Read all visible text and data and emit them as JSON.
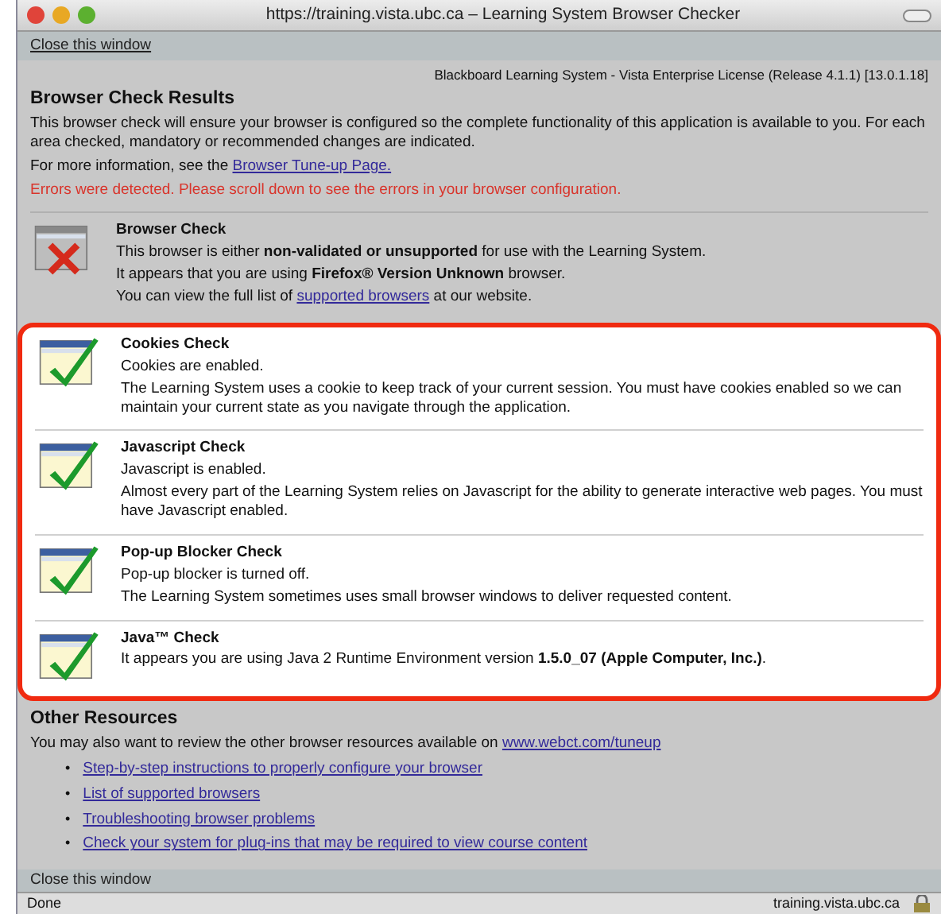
{
  "window": {
    "title": "https://training.vista.ubc.ca – Learning System Browser Checker"
  },
  "top_link": "Close this window",
  "license": "Blackboard Learning System - Vista Enterprise License (Release 4.1.1) [13.0.1.18]",
  "heading": "Browser Check Results",
  "intro": "This browser check will ensure your browser is configured so the complete functionality of this application is available to you. For each area checked, mandatory or recommended changes are indicated.",
  "more_info": {
    "before": "For more information, see the ",
    "link": "Browser Tune-up Page."
  },
  "error": "Errors were detected. Please scroll down to see the errors in your browser configuration.",
  "checks": [
    {
      "title": "Browser Check",
      "passed": false,
      "highlighted": false,
      "lines": [
        {
          "text": "This browser is either **non-validated or unsupported** for use with the Learning System."
        },
        {
          "text": "It appears that you are using **Firefox® Version Unknown** browser."
        },
        {
          "before": "You can view the full list of ",
          "link": "supported browsers",
          "after": " at our website."
        }
      ]
    },
    {
      "title": "Cookies Check",
      "passed": true,
      "highlighted": true,
      "lines": [
        {
          "text": "Cookies are enabled."
        },
        {
          "text": "The Learning System uses a cookie to keep track of your current session. You must have cookies enabled so we can maintain your current state as you navigate through the application."
        }
      ]
    },
    {
      "title": "Javascript Check",
      "passed": true,
      "highlighted": true,
      "lines": [
        {
          "text": "Javascript is enabled."
        },
        {
          "text": "Almost every part of the Learning System relies on Javascript for the ability to generate interactive web pages. You must have Javascript enabled."
        }
      ]
    },
    {
      "title": "Pop-up Blocker Check",
      "passed": true,
      "highlighted": true,
      "lines": [
        {
          "text": "Pop-up blocker is turned off."
        },
        {
          "text": "The Learning System sometimes uses small browser windows to deliver requested content."
        }
      ]
    },
    {
      "title": "Java™ Check",
      "passed": true,
      "highlighted": true,
      "lines": [
        {
          "text": "It appears you are using Java 2 Runtime Environment version **1.5.0_07 (Apple Computer, Inc.)**."
        }
      ]
    }
  ],
  "other_resources": {
    "heading": "Other Resources",
    "intro": {
      "before": "You may also want to review the other browser resources available on ",
      "link": "www.webct.com/tuneup"
    },
    "links": [
      {
        "bullet": "•",
        "text": "Step-by-step instructions to properly configure your browser"
      },
      {
        "bullet": "•",
        "text": "List of supported browsers"
      },
      {
        "bullet": "•",
        "text": "Troubleshooting browser problems"
      },
      {
        "bullet": "•",
        "text": "Check your system for plug-ins that may be required to view course content"
      }
    ]
  },
  "bottom_link": "Close this window",
  "status_bar": {
    "status": "Done",
    "host": "training.vista.ubc.ca"
  }
}
